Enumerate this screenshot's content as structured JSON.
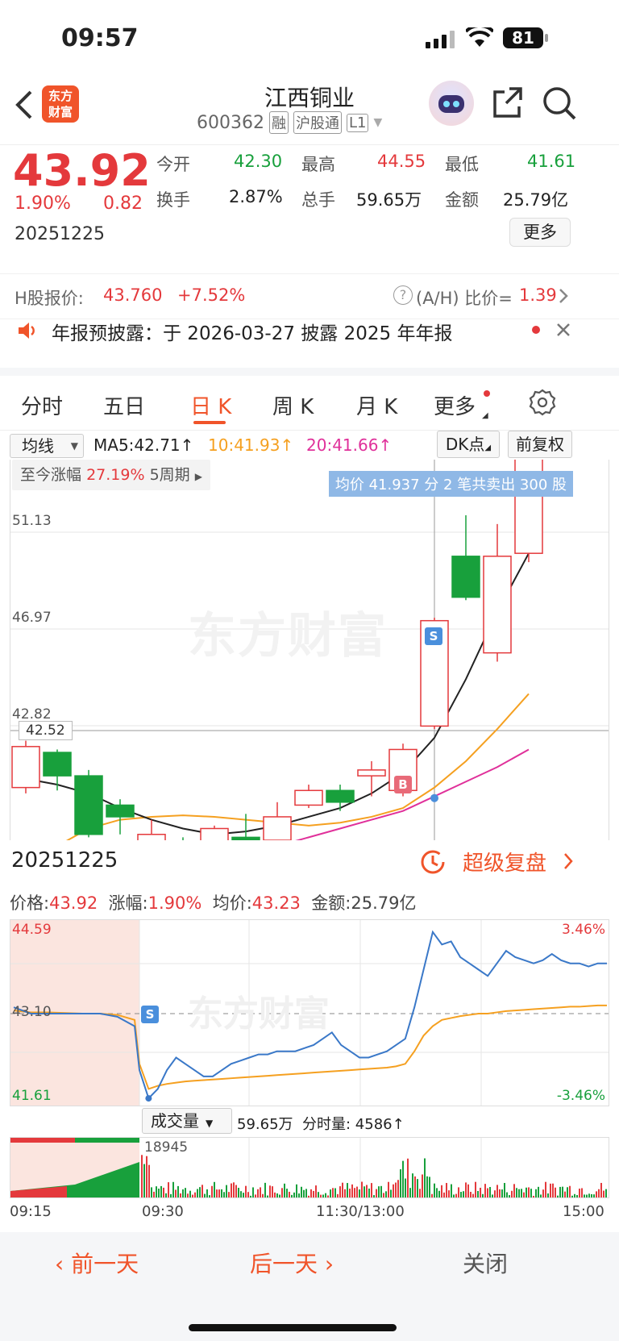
{
  "status": {
    "time": "09:57",
    "battery": "81"
  },
  "header": {
    "title": "江西铜业",
    "code": "600362",
    "badges": [
      "融",
      "沪股通",
      "L1"
    ],
    "logo_text": "东方财富"
  },
  "quote": {
    "price": "43.92",
    "change_pct": "1.90%",
    "change": "0.82",
    "date": "20251225",
    "open_label": "今开",
    "open": "42.30",
    "high_label": "最高",
    "high": "44.55",
    "low_label": "最低",
    "low": "41.61",
    "turnover_label": "换手",
    "turnover": "2.87%",
    "volume_label": "总手",
    "volume": "59.65万",
    "amount_label": "金额",
    "amount": "25.79亿",
    "more_label": "更多"
  },
  "hshare": {
    "label": "H股报价:",
    "price": "43.760",
    "pct": "+7.52%",
    "ratio_label": "(A/H) 比价=",
    "ratio": "1.39"
  },
  "notice": {
    "text": "年报预披露：于 2026-03-27 披露 2025 年年报"
  },
  "tabs": [
    "分时",
    "五日",
    "日 K",
    "周 K",
    "月 K",
    "更多"
  ],
  "active_tab": 2,
  "ma": {
    "select": "均线",
    "ma5": "MA5:42.71",
    "ma10": "10:41.93",
    "ma20": "20:41.66",
    "dk": "DK点",
    "fq": "前复权"
  },
  "kchart": {
    "range_label": "至今涨幅",
    "range_pct": "27.19%",
    "range_period": "5周期",
    "tooltip": "均价 41.937 分 2 笔共卖出 300 股",
    "price_labels": [
      "51.13",
      "46.97",
      "42.82"
    ],
    "cursor_label": "42.52",
    "watermark": "东方财富",
    "marker_s": "S",
    "marker_b": "B"
  },
  "chart_data": {
    "type": "candlestick",
    "ylim": [
      40.5,
      53.5
    ],
    "candles": [
      {
        "o": 42.3,
        "c": 43.7,
        "h": 43.9,
        "l": 42.1
      },
      {
        "o": 43.5,
        "c": 42.7,
        "h": 43.6,
        "l": 42.2
      },
      {
        "o": 42.7,
        "c": 40.7,
        "h": 42.9,
        "l": 40.6
      },
      {
        "o": 41.7,
        "c": 41.3,
        "h": 41.9,
        "l": 40.7
      },
      {
        "o": 39.9,
        "c": 40.7,
        "h": 41.2,
        "l": 39.8
      },
      {
        "o": 40.4,
        "c": 40.0,
        "h": 40.6,
        "l": 39.6
      },
      {
        "o": 40.3,
        "c": 40.9,
        "h": 41.0,
        "l": 40.0
      },
      {
        "o": 40.6,
        "c": 40.5,
        "h": 41.4,
        "l": 40.3
      },
      {
        "o": 40.5,
        "c": 41.3,
        "h": 41.8,
        "l": 40.0
      },
      {
        "o": 41.7,
        "c": 42.2,
        "h": 42.4,
        "l": 41.6
      },
      {
        "o": 42.2,
        "c": 41.8,
        "h": 42.4,
        "l": 41.5
      },
      {
        "o": 42.7,
        "c": 42.9,
        "h": 43.2,
        "l": 42.0
      },
      {
        "o": 42.2,
        "c": 43.6,
        "h": 43.8,
        "l": 42.0
      },
      {
        "o": 44.4,
        "c": 48.0,
        "h": 48.1,
        "l": 44.3
      },
      {
        "o": 50.2,
        "c": 48.8,
        "h": 51.6,
        "l": 48.7
      },
      {
        "o": 46.9,
        "c": 50.2,
        "h": 51.3,
        "l": 46.6
      },
      {
        "o": 50.3,
        "c": 55.0,
        "h": 56.0,
        "l": 50.0
      }
    ],
    "ma5": [
      42.6,
      42.4,
      42.1,
      41.6,
      41.2,
      40.9,
      40.7,
      40.8,
      41.0,
      41.3,
      41.6,
      42.1,
      42.8,
      44.0,
      46.0,
      48.3,
      50.3
    ],
    "ma10": [
      39.6,
      40.3,
      40.9,
      41.2,
      41.3,
      41.35,
      41.3,
      41.2,
      41.1,
      41.0,
      41.1,
      41.3,
      41.6,
      42.3,
      43.2,
      44.3,
      45.5
    ],
    "ma20": [
      37.0,
      37.5,
      38.0,
      38.5,
      39.0,
      39.5,
      39.8,
      40.0,
      40.3,
      40.6,
      40.9,
      41.2,
      41.5,
      42.0,
      42.5,
      43.0,
      43.6
    ]
  },
  "daybar": {
    "date": "20251225",
    "replay": "超级复盘"
  },
  "minute": {
    "price_label": "价格:",
    "price": "43.92",
    "pct_label": "涨幅:",
    "pct": "1.90%",
    "avg_label": "均价:",
    "avg": "43.23",
    "amount_label": "金额:",
    "amount": "25.79亿",
    "ymax": "44.59",
    "ymid": "43.10",
    "ymin": "41.61",
    "pmax": "3.46%",
    "pmin": "-3.46%",
    "watermark": "东方财富",
    "marker": "S"
  },
  "minute_data": {
    "ylim": [
      41.61,
      44.59
    ],
    "price": [
      43.2,
      43.1,
      43.1,
      43.1,
      43.1,
      43.1,
      43.05,
      42.9,
      42.2,
      41.75,
      41.9,
      42.2,
      42.4,
      42.3,
      42.2,
      42.1,
      42.1,
      42.2,
      42.3,
      42.35,
      42.4,
      42.45,
      42.45,
      42.5,
      42.5,
      42.5,
      42.55,
      42.6,
      42.7,
      42.8,
      42.6,
      42.5,
      42.4,
      42.4,
      42.45,
      42.5,
      42.6,
      42.7,
      43.2,
      43.8,
      44.4,
      44.2,
      44.25,
      44.0,
      43.9,
      43.8,
      43.7,
      43.9,
      44.1,
      44.0,
      43.95,
      43.9,
      43.95,
      44.05,
      43.95,
      43.9,
      43.9,
      43.85,
      43.9,
      43.9
    ],
    "avg": [
      43.15,
      43.12,
      43.12,
      43.11,
      43.1,
      43.1,
      43.08,
      43.0,
      42.3,
      41.9,
      41.95,
      41.98,
      42.0,
      42.02,
      42.03,
      42.04,
      42.05,
      42.06,
      42.07,
      42.08,
      42.09,
      42.1,
      42.11,
      42.12,
      42.13,
      42.14,
      42.15,
      42.16,
      42.17,
      42.18,
      42.19,
      42.2,
      42.21,
      42.22,
      42.23,
      42.24,
      42.26,
      42.3,
      42.5,
      42.75,
      42.9,
      43.0,
      43.03,
      43.06,
      43.08,
      43.1,
      43.1,
      43.12,
      43.14,
      43.15,
      43.16,
      43.17,
      43.18,
      43.19,
      43.2,
      43.21,
      43.21,
      43.22,
      43.23,
      43.23
    ]
  },
  "volume": {
    "select": "成交量",
    "total": "59.65万",
    "minute_label": "分时量:",
    "minute_val": "4586",
    "peak": "18945"
  },
  "time_axis": [
    "09:15",
    "09:30",
    "11:30/13:00",
    "15:00"
  ],
  "nav": {
    "prev": "前一天",
    "next": "后一天",
    "close": "关闭"
  }
}
